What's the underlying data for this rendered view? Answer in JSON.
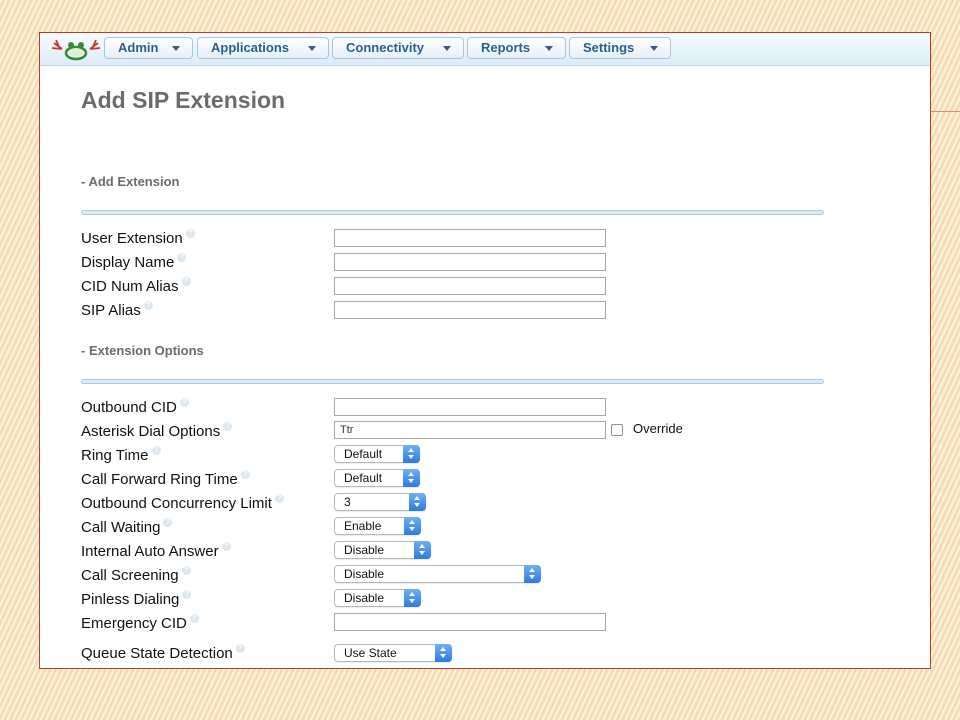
{
  "nav": {
    "items": [
      {
        "label": "Admin"
      },
      {
        "label": "Applications"
      },
      {
        "label": "Connectivity"
      },
      {
        "label": "Reports"
      },
      {
        "label": "Settings"
      }
    ]
  },
  "page": {
    "title": "Add SIP Extension"
  },
  "sections": {
    "add_extension": "- Add Extension",
    "extension_options": "- Extension Options"
  },
  "fields": {
    "user_extension": {
      "label": "User Extension",
      "value": ""
    },
    "display_name": {
      "label": "Display Name",
      "value": ""
    },
    "cid_num_alias": {
      "label": "CID Num Alias",
      "value": ""
    },
    "sip_alias": {
      "label": "SIP Alias",
      "value": ""
    },
    "outbound_cid": {
      "label": "Outbound CID",
      "value": ""
    },
    "asterisk_dial_options": {
      "label": "Asterisk Dial Options",
      "value": "Ttr",
      "override_label": "Override",
      "override_checked": false
    },
    "ring_time": {
      "label": "Ring Time",
      "value": "Default"
    },
    "call_forward_ring_time": {
      "label": "Call Forward Ring Time",
      "value": "Default"
    },
    "outbound_concurrency_limit": {
      "label": "Outbound Concurrency Limit",
      "value": "3"
    },
    "call_waiting": {
      "label": "Call Waiting",
      "value": "Enable"
    },
    "internal_auto_answer": {
      "label": "Internal Auto Answer",
      "value": "Disable"
    },
    "call_screening": {
      "label": "Call Screening",
      "value": "Disable"
    },
    "pinless_dialing": {
      "label": "Pinless Dialing",
      "value": "Disable"
    },
    "emergency_cid": {
      "label": "Emergency CID",
      "value": ""
    },
    "queue_state_detection": {
      "label": "Queue State Detection",
      "value": "Use State"
    }
  },
  "icons": {
    "help": "question-mark-circle",
    "logo": "frog-logo",
    "dropdown": "caret-down",
    "select_stepper": "up-down-stepper"
  },
  "colors": {
    "nav_text": "#2e5f8a",
    "nav_border": "#a9c6df",
    "stepper_blue": "#2a7ae6",
    "title_gray": "#6b6b6b",
    "window_border": "#c0392b"
  }
}
